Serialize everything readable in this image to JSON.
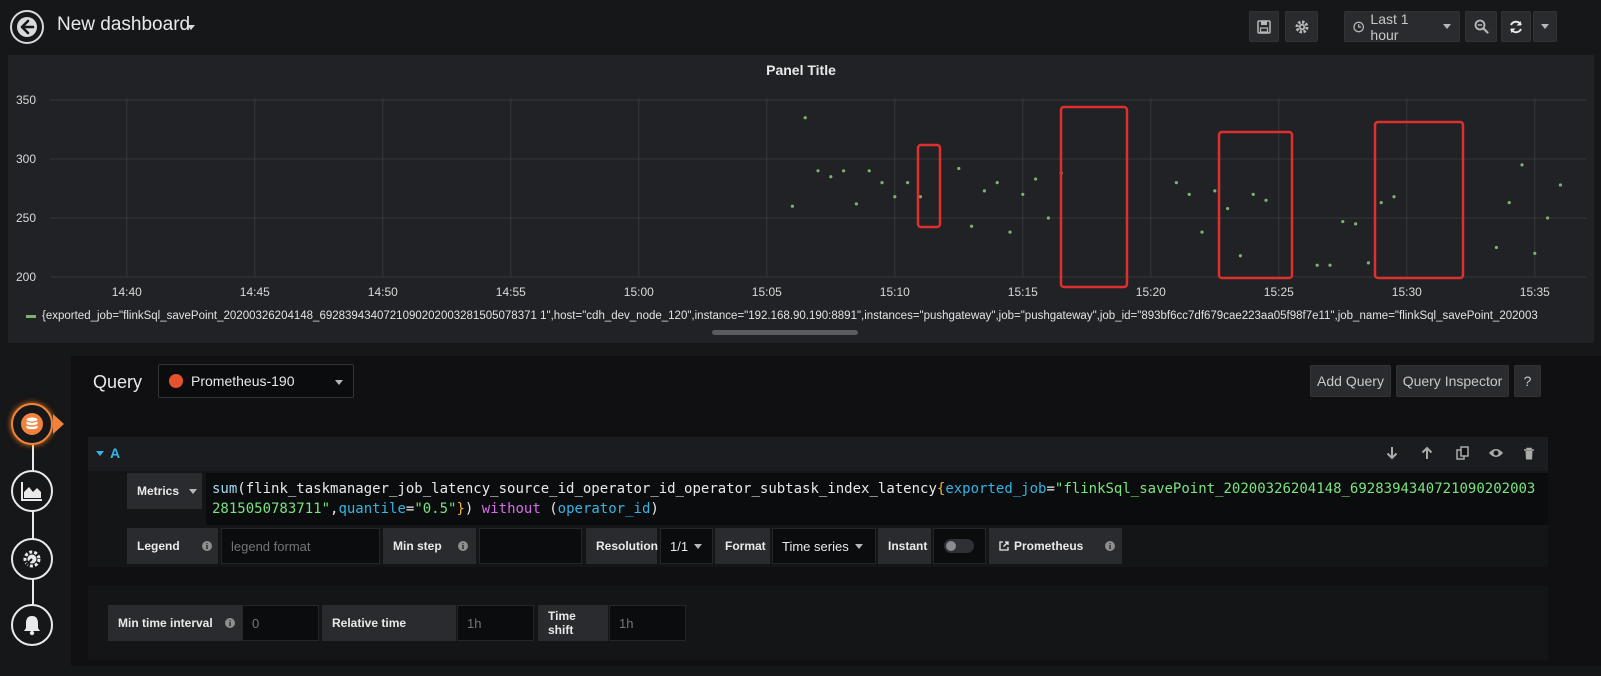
{
  "header": {
    "dashboard_title": "New dashboard",
    "time_range": "Last 1 hour",
    "icons": [
      "back-arrow-icon",
      "save-icon",
      "gear-icon",
      "clock-icon",
      "zoom-out-icon",
      "refresh-icon"
    ]
  },
  "panel": {
    "title": "Panel Title",
    "legend": "{exported_job=\"flinkSql_savePoint_20200326204148_6928394340721090202003281505078371 1\",host=\"cdh_dev_node_120\",instance=\"192.168.90.190:8891\",instances=\"pushgateway\",job=\"pushgateway\",job_id=\"893bf6cc7df679cae223aa05f98f7e11\",job_name=\"flinkSql_savePoint_202003",
    "series_color": "#7eb26d"
  },
  "chart_data": {
    "type": "scatter",
    "xlabel": "",
    "ylabel": "",
    "y_ticks": [
      "350",
      "300",
      "250",
      "200"
    ],
    "x_ticks": [
      "14:40",
      "14:45",
      "14:50",
      "14:55",
      "15:00",
      "15:05",
      "15:10",
      "15:15",
      "15:20",
      "15:25",
      "15:30",
      "15:35"
    ],
    "ylim": [
      200,
      350
    ],
    "xlim": [
      "14:37",
      "15:37"
    ],
    "grid": true,
    "series": [
      {
        "name": "{exported_job=\"flinkSql_savePoint_20200326204148_69283943407210902020032815050783711\"}",
        "points": [
          {
            "x": "15:06:00",
            "y": 260
          },
          {
            "x": "15:06:30",
            "y": 335
          },
          {
            "x": "15:07:00",
            "y": 290
          },
          {
            "x": "15:07:30",
            "y": 285
          },
          {
            "x": "15:08:00",
            "y": 290
          },
          {
            "x": "15:08:30",
            "y": 262
          },
          {
            "x": "15:09:00",
            "y": 290
          },
          {
            "x": "15:09:30",
            "y": 280
          },
          {
            "x": "15:10:00",
            "y": 268
          },
          {
            "x": "15:10:30",
            "y": 280
          },
          {
            "x": "15:11:00",
            "y": 268
          },
          {
            "x": "15:12:30",
            "y": 292
          },
          {
            "x": "15:13:00",
            "y": 243
          },
          {
            "x": "15:13:30",
            "y": 273
          },
          {
            "x": "15:14:00",
            "y": 280
          },
          {
            "x": "15:14:30",
            "y": 238
          },
          {
            "x": "15:15:00",
            "y": 270
          },
          {
            "x": "15:15:30",
            "y": 283
          },
          {
            "x": "15:16:00",
            "y": 250
          },
          {
            "x": "15:16:30",
            "y": 288
          },
          {
            "x": "15:21:00",
            "y": 280
          },
          {
            "x": "15:21:30",
            "y": 270
          },
          {
            "x": "15:22:00",
            "y": 238
          },
          {
            "x": "15:22:30",
            "y": 273
          },
          {
            "x": "15:23:00",
            "y": 258
          },
          {
            "x": "15:23:30",
            "y": 218
          },
          {
            "x": "15:24:00",
            "y": 270
          },
          {
            "x": "15:24:30",
            "y": 265
          },
          {
            "x": "15:26:30",
            "y": 210
          },
          {
            "x": "15:27:00",
            "y": 210
          },
          {
            "x": "15:27:30",
            "y": 247
          },
          {
            "x": "15:28:00",
            "y": 245
          },
          {
            "x": "15:28:30",
            "y": 212
          },
          {
            "x": "15:29:00",
            "y": 263
          },
          {
            "x": "15:29:30",
            "y": 268
          },
          {
            "x": "15:33:30",
            "y": 225
          },
          {
            "x": "15:34:00",
            "y": 263
          },
          {
            "x": "15:34:30",
            "y": 295
          },
          {
            "x": "15:35:00",
            "y": 220
          },
          {
            "x": "15:35:30",
            "y": 250
          },
          {
            "x": "15:36:00",
            "y": 278
          }
        ]
      }
    ],
    "annotation_color": "#e02f2f"
  },
  "editor": {
    "query_label": "Query",
    "datasource": "Prometheus-190",
    "add_query": "Add Query",
    "query_inspector": "Query Inspector",
    "help": "?",
    "sidebar_icons": [
      "database-icon",
      "area-chart-icon",
      "wrench-gear-icon",
      "bell-icon"
    ],
    "query_row": {
      "ref_id": "A",
      "metrics_label": "Metrics",
      "expr": {
        "fn": "sum",
        "metric": "flink_taskmanager_job_latency_source_id_operator_id_operator_subtask_index_latency",
        "k1": "exported_job",
        "v1": "\"flinkSql_savePoint_20200326204148_69283943407210902020032815050783711\"",
        "k2": "quantile",
        "v2": "\"0.5\"",
        "without": "without",
        "grp": "operator_id"
      },
      "legend_label": "Legend",
      "legend_placeholder": "legend format",
      "min_step_label": "Min step",
      "min_step_value": "",
      "resolution_label": "Resolution",
      "resolution_value": "1/1",
      "format_label": "Format",
      "format_value": "Time series",
      "instant_label": "Instant",
      "prometheus_link": "Prometheus"
    },
    "options": {
      "min_time_interval_label": "Min time interval",
      "min_time_interval_placeholder": "0",
      "relative_time_label": "Relative time",
      "relative_time_placeholder": "1h",
      "time_shift_label": "Time shift",
      "time_shift_placeholder": "1h"
    }
  }
}
